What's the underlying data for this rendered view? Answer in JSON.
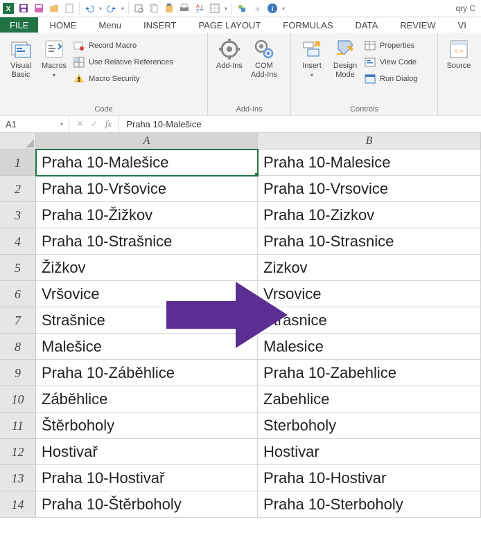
{
  "qat_title": "qry C",
  "menu": {
    "file": "FILE",
    "tabs": [
      "HOME",
      "Menu",
      "INSERT",
      "PAGE LAYOUT",
      "FORMULAS",
      "DATA",
      "REVIEW",
      "VI"
    ]
  },
  "ribbon": {
    "code": {
      "label": "Code",
      "visual_basic": "Visual\nBasic",
      "macros": "Macros",
      "record_macro": "Record Macro",
      "use_rel_refs": "Use Relative References",
      "macro_security": "Macro Security"
    },
    "addins": {
      "label": "Add-Ins",
      "addins_btn": "Add-Ins",
      "com_addins": "COM\nAdd-Ins"
    },
    "controls": {
      "label": "Controls",
      "insert": "Insert",
      "design_mode": "Design\nMode",
      "properties": "Properties",
      "view_code": "View Code",
      "run_dialog": "Run Dialog"
    },
    "xml": {
      "source": "Source"
    }
  },
  "formula_bar": {
    "name_box": "A1",
    "content": "Praha 10-Malešice"
  },
  "columns": [
    "A",
    "B"
  ],
  "rows": [
    {
      "n": 1,
      "a": "Praha 10-Malešice",
      "b": "Praha 10-Malesice"
    },
    {
      "n": 2,
      "a": "Praha 10-Vršovice",
      "b": "Praha 10-Vrsovice"
    },
    {
      "n": 3,
      "a": "Praha 10-Žižkov",
      "b": "Praha 10-Zizkov"
    },
    {
      "n": 4,
      "a": "Praha 10-Strašnice",
      "b": "Praha 10-Strasnice"
    },
    {
      "n": 5,
      "a": "Žižkov",
      "b": "Zizkov"
    },
    {
      "n": 6,
      "a": "Vršovice",
      "b": "Vrsovice"
    },
    {
      "n": 7,
      "a": "Strašnice",
      "b": "Strasnice"
    },
    {
      "n": 8,
      "a": "Malešice",
      "b": "Malesice"
    },
    {
      "n": 9,
      "a": "Praha 10-Záběhlice",
      "b": "Praha 10-Zabehlice"
    },
    {
      "n": 10,
      "a": "Záběhlice",
      "b": "Zabehlice"
    },
    {
      "n": 11,
      "a": "Štěrboholy",
      "b": "Sterboholy"
    },
    {
      "n": 12,
      "a": "Hostivař",
      "b": "Hostivar"
    },
    {
      "n": 13,
      "a": "Praha 10-Hostivař",
      "b": "Praha 10-Hostivar"
    },
    {
      "n": 14,
      "a": "Praha 10-Štěrboholy",
      "b": "Praha 10-Sterboholy"
    }
  ],
  "active_cell": "A1",
  "colors": {
    "excel_green": "#217346",
    "arrow": "#5b2e91"
  }
}
